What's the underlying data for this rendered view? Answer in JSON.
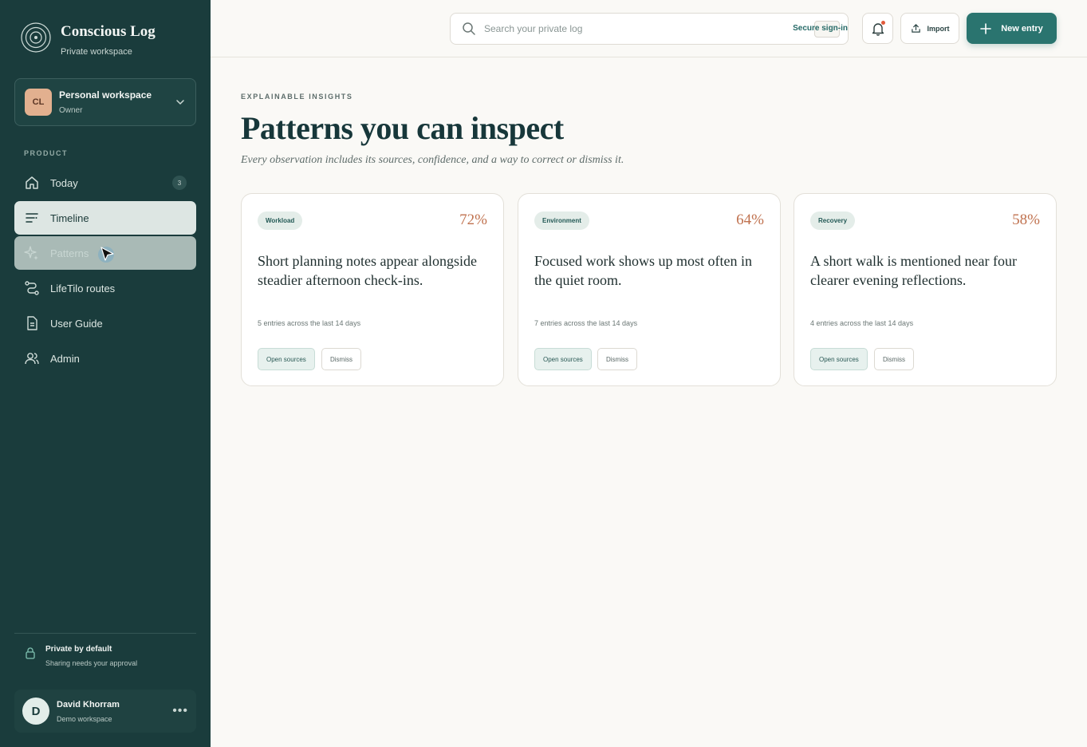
{
  "brand": {
    "title": "Conscious Log",
    "subtitle": "Private workspace"
  },
  "workspace": {
    "initials": "CL",
    "name": "Personal workspace",
    "role": "Owner"
  },
  "sidebar": {
    "section_label": "PRODUCT",
    "items": [
      {
        "label": "Today",
        "icon": "home-icon",
        "badge": "3"
      },
      {
        "label": "Timeline",
        "icon": "timeline-icon",
        "state": "active"
      },
      {
        "label": "Patterns",
        "icon": "sparkle-icon",
        "state": "hover"
      },
      {
        "label": "LifeTilo routes",
        "icon": "route-icon"
      },
      {
        "label": "User Guide",
        "icon": "document-icon"
      },
      {
        "label": "Admin",
        "icon": "users-icon"
      }
    ],
    "privacy": {
      "title": "Private by default",
      "subtitle": "Sharing needs your approval"
    },
    "user": {
      "initial": "D",
      "name": "David Khorram",
      "workspace": "Demo workspace"
    }
  },
  "header": {
    "search_placeholder": "Search your private log",
    "secure_label": "Secure sign-in",
    "import_label": "Import",
    "new_entry_label": "New entry"
  },
  "main": {
    "eyebrow": "EXPLAINABLE INSIGHTS",
    "title": "Patterns you can inspect",
    "subtitle": "Every observation includes its sources, confidence, and a way to correct or dismiss it.",
    "cards": [
      {
        "tag": "Workload",
        "confidence": "72%",
        "text": "Short planning notes appear alongside steadier afternoon check-ins.",
        "meta": "5 entries across the last 14 days",
        "open_label": "Open sources",
        "dismiss_label": "Dismiss"
      },
      {
        "tag": "Environment",
        "confidence": "64%",
        "text": "Focused work shows up most often in the quiet room.",
        "meta": "7 entries across the last 14 days",
        "open_label": "Open sources",
        "dismiss_label": "Dismiss"
      },
      {
        "tag": "Recovery",
        "confidence": "58%",
        "text": "A short walk is mentioned near four clearer evening reflections.",
        "meta": "4 entries across the last 14 days",
        "open_label": "Open sources",
        "dismiss_label": "Dismiss"
      }
    ]
  },
  "colors": {
    "sidebar": "#1a3c3c",
    "accent": "#2a746f",
    "confidence": "#c0724f",
    "background": "#faf9f6"
  }
}
